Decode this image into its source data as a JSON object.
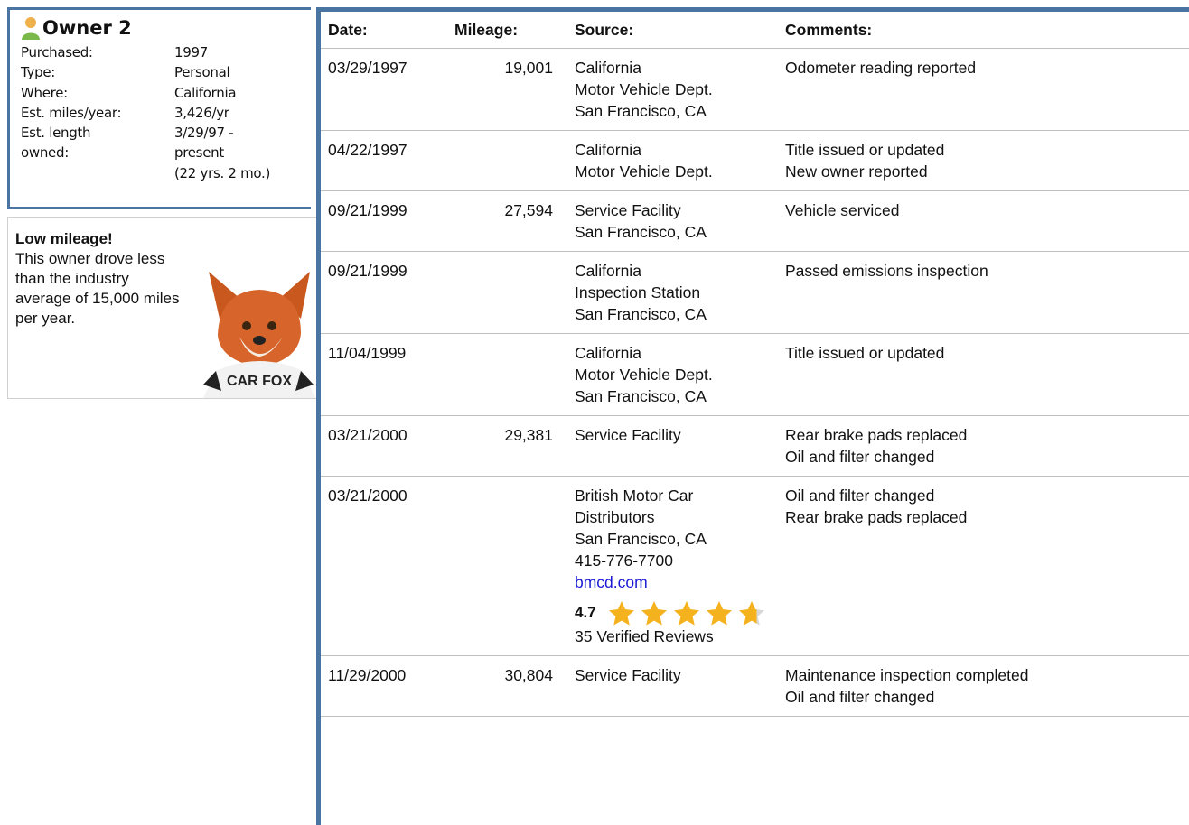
{
  "owner": {
    "title": "Owner 2",
    "rows": [
      {
        "label": "Purchased:",
        "value": "1997"
      },
      {
        "label": "Type:",
        "value": "Personal"
      },
      {
        "label": "Where:",
        "value": "California"
      },
      {
        "label": "Est. miles/year:",
        "value": "3,426/yr"
      },
      {
        "label": "Est. length",
        "value": "3/29/97 -"
      },
      {
        "label": "owned:",
        "value": "present"
      },
      {
        "label": "",
        "value": "(22 yrs. 2 mo.)"
      }
    ]
  },
  "tip": {
    "title": "Low mileage!",
    "text": "This owner drove less than the industry average of 15,000 miles per year.",
    "mascot_text": "CAR FOX"
  },
  "history": {
    "headers": {
      "date": "Date:",
      "mileage": "Mileage:",
      "source": "Source:",
      "comments": "Comments:"
    },
    "rows": [
      {
        "date": "03/29/1997",
        "mileage": "19,001",
        "source": [
          "California",
          "Motor Vehicle Dept.",
          "San Francisco, CA"
        ],
        "comments": [
          "Odometer reading reported"
        ]
      },
      {
        "date": "04/22/1997",
        "mileage": "",
        "source": [
          "California",
          "Motor Vehicle Dept."
        ],
        "comments": [
          "Title issued or updated",
          "New owner reported"
        ]
      },
      {
        "date": "09/21/1999",
        "mileage": "27,594",
        "source": [
          "Service Facility",
          "San Francisco, CA"
        ],
        "comments": [
          "Vehicle serviced"
        ]
      },
      {
        "date": "09/21/1999",
        "mileage": "",
        "source": [
          "California",
          "Inspection Station",
          "San Francisco, CA"
        ],
        "comments": [
          "Passed emissions inspection"
        ]
      },
      {
        "date": "11/04/1999",
        "mileage": "",
        "source": [
          "California",
          "Motor Vehicle Dept.",
          "San Francisco, CA"
        ],
        "comments": [
          "Title issued or updated"
        ]
      },
      {
        "date": "03/21/2000",
        "mileage": "29,381",
        "source": [
          "Service Facility"
        ],
        "comments": [
          "Rear brake pads replaced",
          "Oil and filter changed"
        ]
      },
      {
        "date": "03/21/2000",
        "mileage": "",
        "source": [
          "British Motor Car",
          "Distributors",
          "San Francisco, CA",
          "415-776-7700"
        ],
        "link": "bmcd.com",
        "rating": {
          "score": "4.7",
          "stars": 4.7,
          "reviews": "35 Verified Reviews"
        },
        "comments": [
          "Oil and filter changed",
          "Rear brake pads replaced"
        ]
      },
      {
        "date": "11/29/2000",
        "mileage": "30,804",
        "source": [
          "Service Facility"
        ],
        "comments": [
          "Maintenance inspection completed",
          "Oil and filter changed"
        ]
      }
    ]
  },
  "colors": {
    "accent": "#4a75a3",
    "link": "#1a1ad6",
    "star": "#f5b21f",
    "star_empty": "#d8d8d8"
  },
  "icons": {
    "owner": "person-icon",
    "rating": "star-icon"
  }
}
